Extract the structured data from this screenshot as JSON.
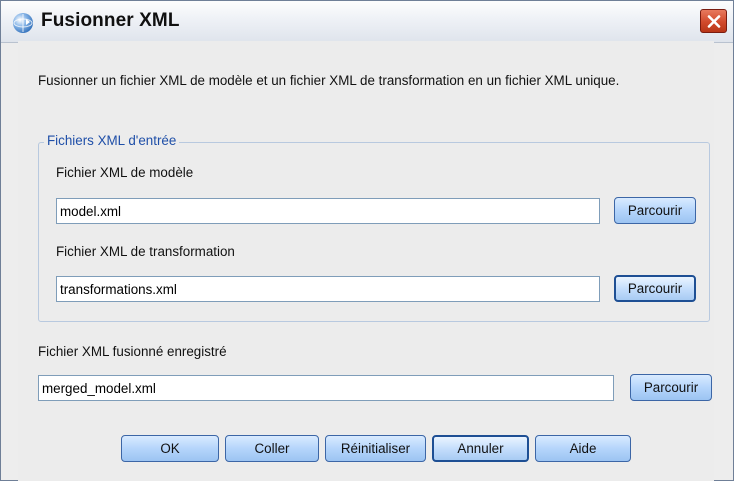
{
  "window": {
    "title": "Fusionner XML"
  },
  "icons": {
    "app": "application-globe-icon",
    "close": "close-icon"
  },
  "description": "Fusionner un fichier XML de modèle et un fichier XML de transformation en un fichier XML unique.",
  "input_group": {
    "legend": "Fichiers XML d'entrée",
    "model": {
      "label": "Fichier XML de modèle",
      "value": "model.xml",
      "browse_label": "Parcourir"
    },
    "transform": {
      "label": "Fichier XML de transformation",
      "value": "transformations.xml",
      "browse_label": "Parcourir"
    }
  },
  "output": {
    "label": "Fichier XML fusionné enregistré",
    "value": "merged_model.xml",
    "browse_label": "Parcourir"
  },
  "buttons": {
    "ok": "OK",
    "paste": "Coller",
    "reset": "Réinitialiser",
    "cancel": "Annuler",
    "help": "Aide"
  },
  "colors": {
    "accent": "#1f4fa8",
    "close_button": "#d14a2c",
    "button_face": "#b5d5fb"
  }
}
